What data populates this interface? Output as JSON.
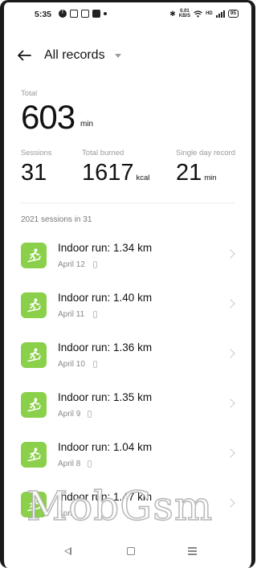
{
  "status_bar": {
    "time": "5:35",
    "speed_top": "0.01",
    "speed_bottom": "KB/S",
    "battery": "95"
  },
  "header": {
    "title": "All records"
  },
  "total": {
    "label": "Total",
    "value": "603",
    "unit": "min"
  },
  "stats": {
    "sessions": {
      "label": "Sessions",
      "value": "31"
    },
    "burned": {
      "label": "Total burned",
      "value": "1617",
      "unit": "kcal"
    },
    "record": {
      "label": "Single day record",
      "value": "21",
      "unit": "min"
    }
  },
  "section_title": "2021 sessions in 31",
  "records": [
    {
      "title": "Indoor run: 1.34 km",
      "date": "April 12"
    },
    {
      "title": "Indoor run: 1.40 km",
      "date": "April 11"
    },
    {
      "title": "Indoor run: 1.36 km",
      "date": "April 10"
    },
    {
      "title": "Indoor run: 1.35 km",
      "date": "April 9"
    },
    {
      "title": "Indoor run: 1.04 km",
      "date": "April 8"
    },
    {
      "title": "Indoor run: 1.47 km",
      "date": "April"
    }
  ],
  "watermark": "MobGsm",
  "colors": {
    "accent_green": "#8bd04a",
    "muted_text": "#9a9a9a"
  },
  "icons": {
    "back": "arrow-left-icon",
    "dropdown": "caret-down-icon",
    "record": "treadmill-runner-icon",
    "row": "chevron-right-icon"
  }
}
